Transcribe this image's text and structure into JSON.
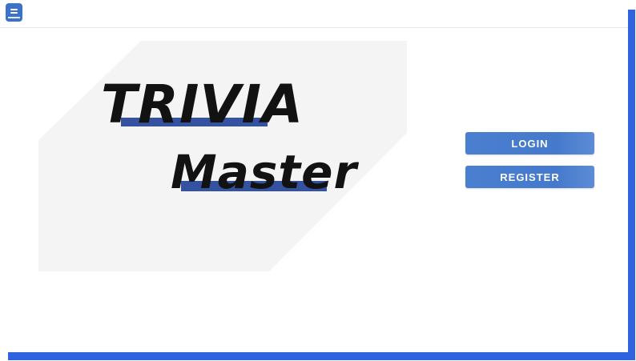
{
  "app": {
    "menu_icon": "notebook-menu-icon",
    "accent_color": "#3d72c9",
    "frame_color": "#2f63e0"
  },
  "hero": {
    "title_line1": "TRIVIA",
    "title_line2": "Master",
    "highlight_color": "#3552a0"
  },
  "actions": {
    "login_label": "LOGIN",
    "register_label": "REGISTER"
  }
}
